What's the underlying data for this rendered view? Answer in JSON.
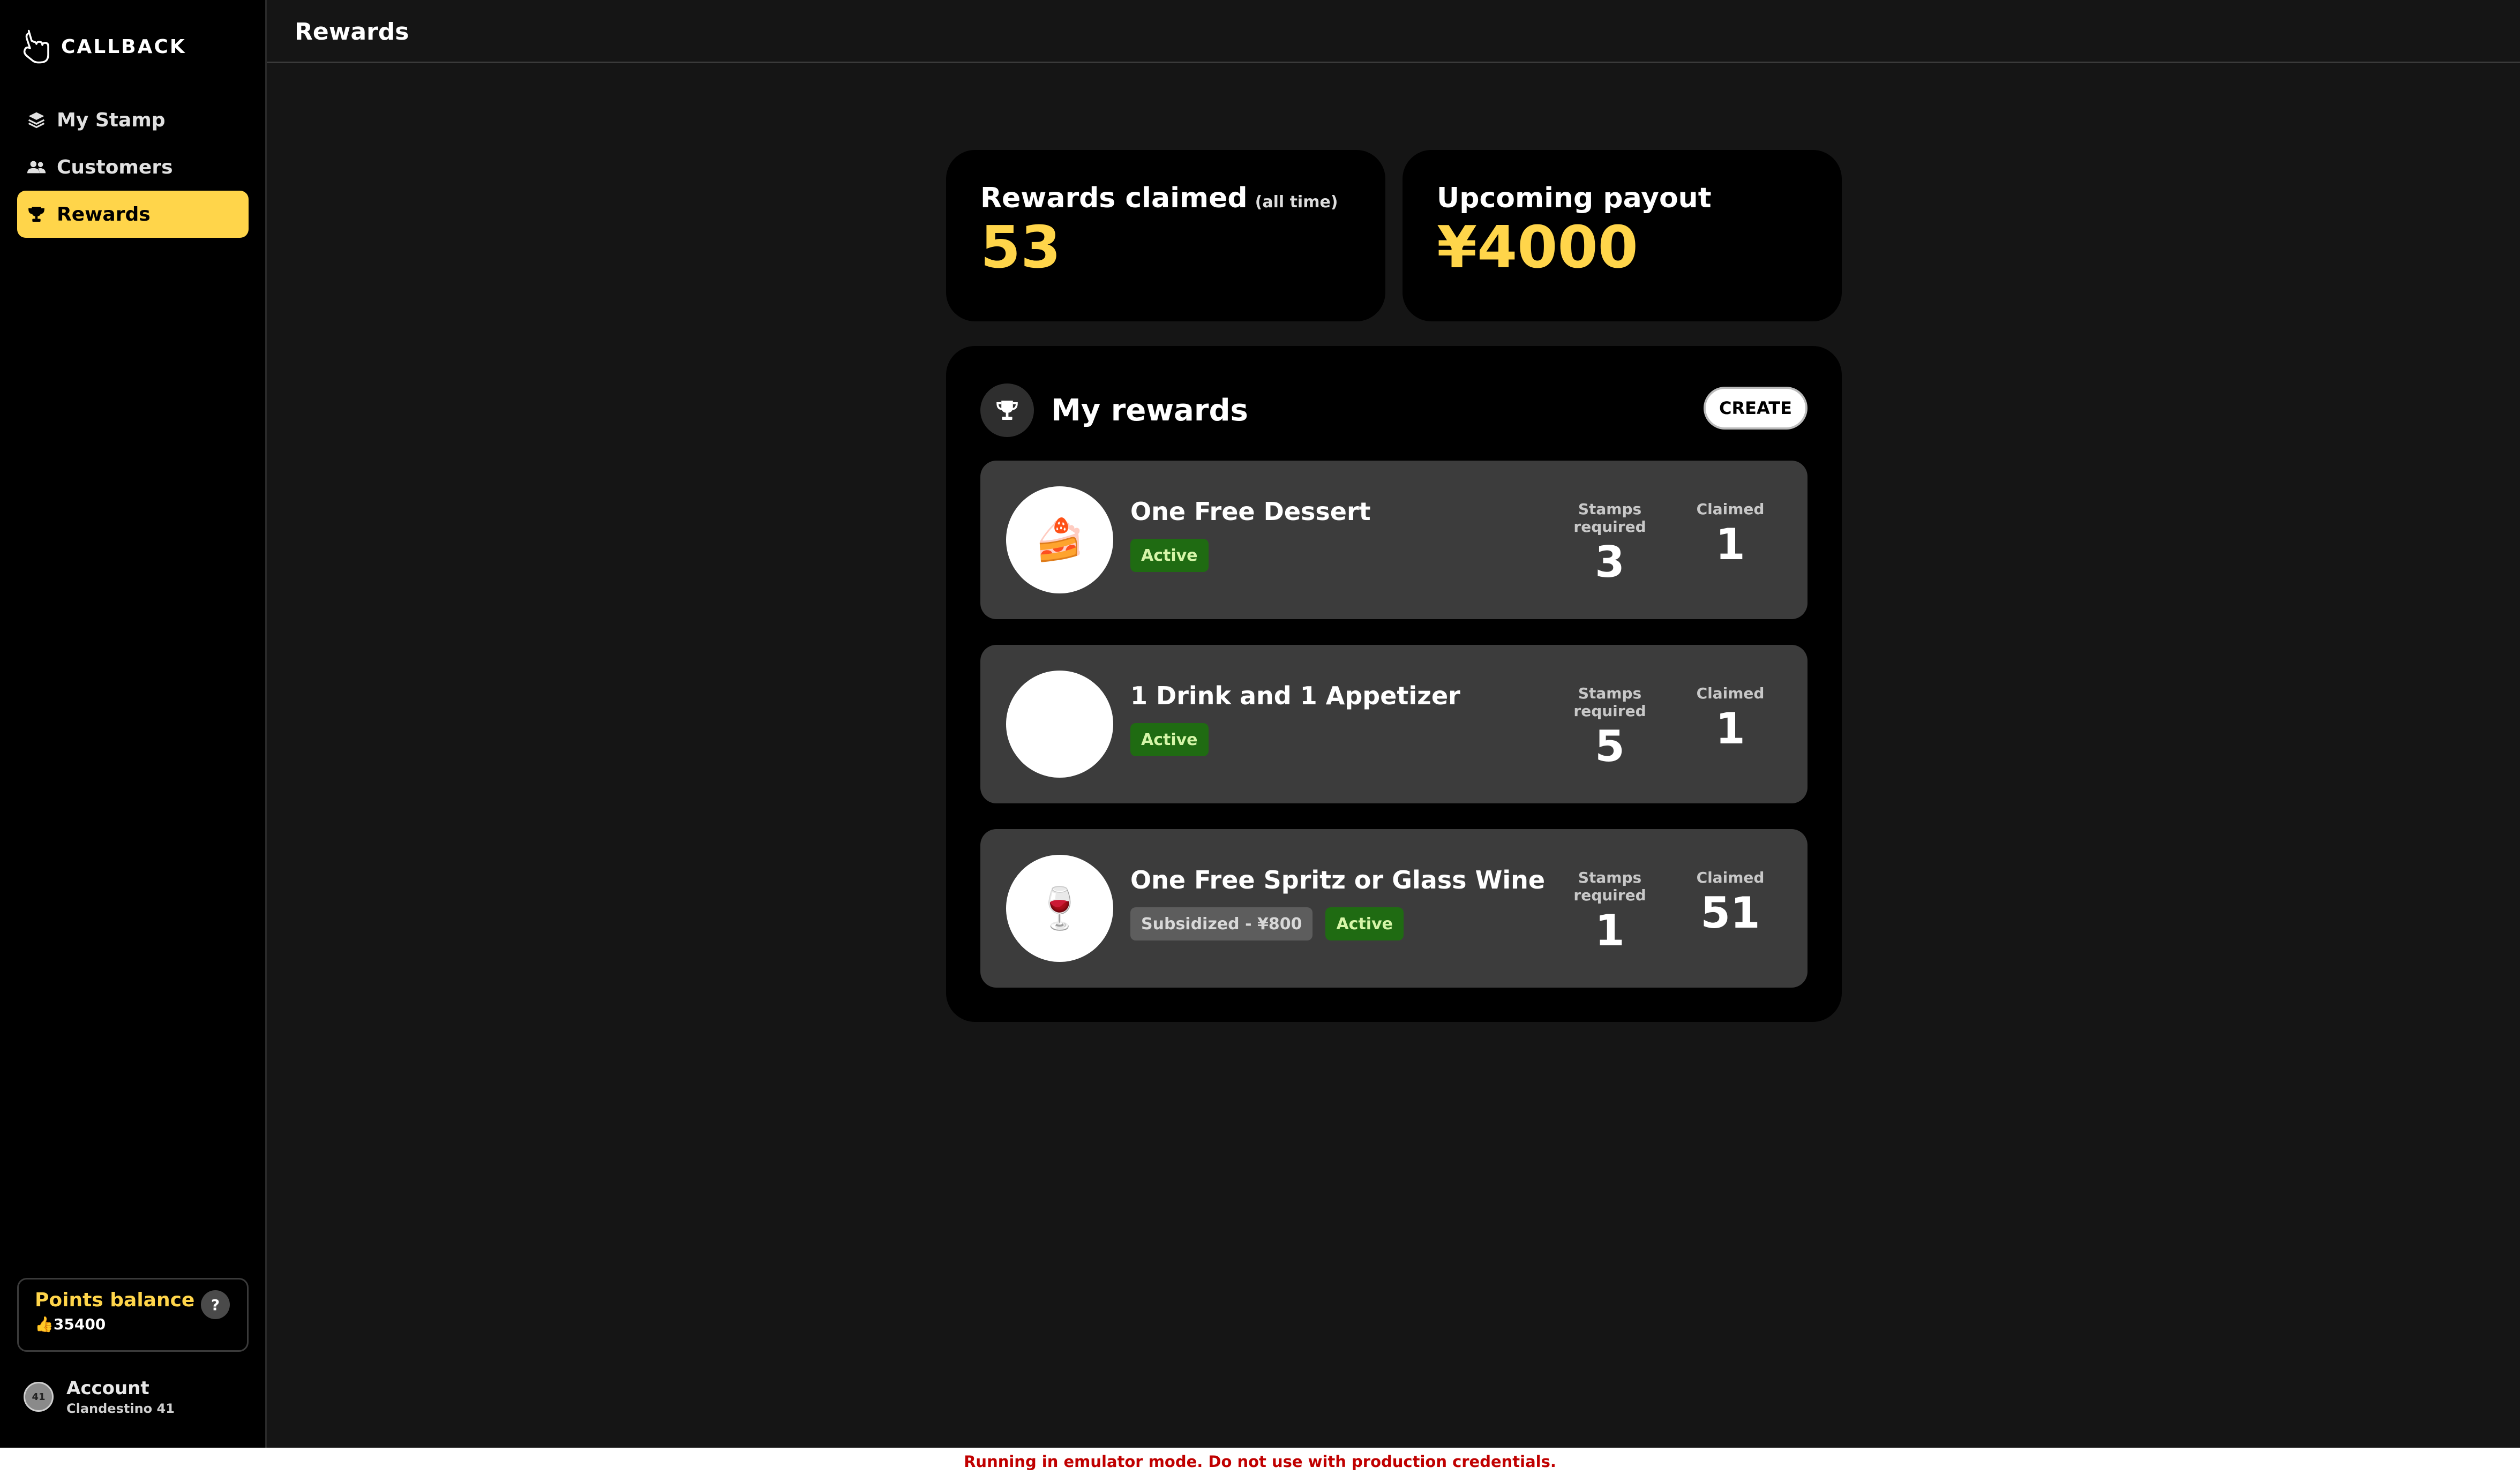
{
  "brand": {
    "name": "CALLBACK"
  },
  "nav": [
    {
      "label": "My Stamp",
      "icon": "layers-icon"
    },
    {
      "label": "Customers",
      "icon": "users-icon"
    },
    {
      "label": "Rewards",
      "icon": "trophy-icon",
      "active": true
    }
  ],
  "header": {
    "title": "Rewards"
  },
  "stats": {
    "claimed": {
      "label": "Rewards claimed",
      "note": "(all time)",
      "value": "53"
    },
    "payout": {
      "label": "Upcoming payout",
      "value": "¥4000"
    }
  },
  "rewards": {
    "title": "My rewards",
    "create_label": "CREATE",
    "stamps_header": "Stamps required",
    "claimed_header": "Claimed",
    "items": [
      {
        "emoji": "🍰",
        "name": "One Free Dessert",
        "status": "Active",
        "stamps": "3",
        "claimed": "1"
      },
      {
        "emoji": "😍",
        "name": "1 Drink and 1 Appetizer",
        "status": "Active",
        "stamps": "5",
        "claimed": "1"
      },
      {
        "emoji": "🍷",
        "name": "One Free Spritz or Glass Wine",
        "subsidy": "Subsidized - ¥800",
        "status": "Active",
        "stamps": "1",
        "claimed": "51"
      }
    ]
  },
  "points": {
    "title": "Points balance",
    "emoji": "👍",
    "value": "35400",
    "help": "?"
  },
  "account": {
    "label": "Account",
    "name": "Clandestino 41",
    "avatar_text": "41"
  },
  "banner": {
    "text": "Running in emulator mode. Do not use with production credentials."
  },
  "colors": {
    "accent": "#ffd54a",
    "active_tag": "#1f6b12",
    "warning": "#c00000"
  }
}
